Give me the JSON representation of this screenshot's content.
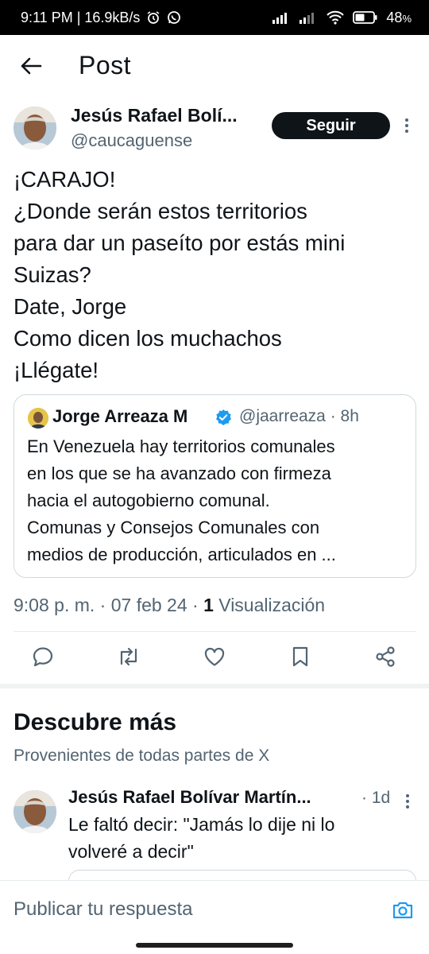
{
  "status_bar": {
    "time_speed": "9:11 PM | 16.9kB/s",
    "battery": "48",
    "battery_unit": "%",
    "icons": [
      "alarm-icon",
      "whatsapp-icon",
      "signal-icon",
      "signal-icon",
      "wifi-icon",
      "battery-icon"
    ]
  },
  "header": {
    "back_icon": "arrow-left-icon",
    "title": "Post"
  },
  "post": {
    "author_name": "Jesús Rafael Bolí...",
    "author_handle": "@caucaguense",
    "follow_label": "Seguir",
    "text_lines": [
      "¡CARAJO!",
      "¿Donde serán estos territorios",
      "para dar un paseíto por estás mini",
      "Suizas?",
      "Date, Jorge",
      "Como dicen los muchachos",
      "¡Llégate!"
    ],
    "quote": {
      "name": "Jorge Arreaza M",
      "meta": "@jaarreaza · 8h",
      "text_lines": [
        "En Venezuela hay territorios comunales",
        "en los que se ha avanzado con firmeza",
        "hacia el autogobierno comunal.",
        "Comunas y Consejos Comunales con",
        "medios de producción, articulados en ..."
      ]
    },
    "timestamp": "9:08 p. m. · 07 feb 24 · ",
    "views_count": "1",
    "views_label": " Visualización",
    "actions": [
      "reply-icon",
      "repost-icon",
      "like-icon",
      "bookmark-icon",
      "share-icon"
    ]
  },
  "discover": {
    "title": "Descubre más",
    "subtitle": "Provenientes de todas partes de X",
    "item": {
      "name": "Jesús Rafael Bolívar Martín...",
      "time": "· 1d",
      "text_lines": [
        "Le faltó decir: \"Jamás lo dije ni lo",
        "volveré a decir\""
      ]
    }
  },
  "reply_bar": {
    "placeholder": "Publicar tu respuesta",
    "camera_icon": "camera-icon"
  },
  "colors": {
    "text": "#0f1419",
    "muted": "#536471",
    "accent": "#1d9bf0",
    "border": "#cfd9de"
  }
}
